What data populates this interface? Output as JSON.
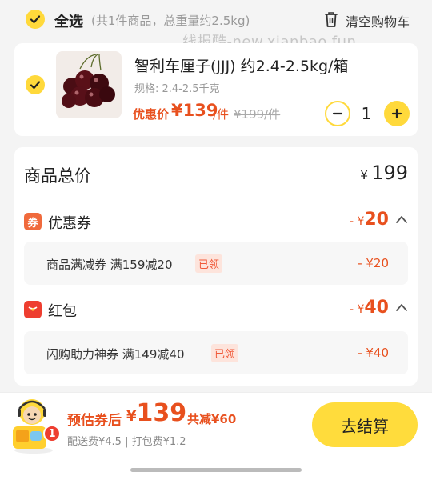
{
  "header": {
    "select_all_label": "全选",
    "select_all_summary": "(共1件商品，总重量约2.5kg)",
    "clear_cart_label": "清空购物车",
    "watermark": "线报酷-new.xianbao.fun"
  },
  "item": {
    "title": "智利车厘子(JJJ) 约2.4-2.5kg/箱",
    "spec": "规格: 2.4-2.5千克",
    "price_prefix": "优惠价",
    "price": "¥139",
    "price_unit": "/件",
    "original_price": "¥199/件",
    "quantity": "1"
  },
  "summary": {
    "total_label": "商品总价",
    "total_yen": "¥",
    "total_value": "199",
    "coupon": {
      "icon_text": "券",
      "label": "优惠券",
      "amount_prefix": "- ¥",
      "amount": "20",
      "detail_text": "商品满减券 满159减20",
      "detail_badge": "已领",
      "detail_amount": "- ¥20"
    },
    "hongbao": {
      "label": "红包",
      "amount_prefix": "- ¥",
      "amount": "40",
      "detail_text": "闪购助力神券 满149减40",
      "detail_badge": "已领",
      "detail_amount": "- ¥40"
    }
  },
  "footer": {
    "cart_count": "1",
    "estimate_label": "预估券后",
    "estimate_yen": "¥",
    "estimate_value": "139",
    "total_reduce": "共减¥60",
    "fees": "配送费¥4.5 | 打包费¥1.2",
    "checkout_label": "去结算"
  },
  "colors": {
    "accent_yellow": "#ffd93b",
    "price_red": "#e8501e",
    "badge_red": "#ee3e30"
  },
  "icons": [
    "check-icon",
    "trash-icon",
    "minus-icon",
    "plus-icon",
    "coupon-icon",
    "hongbao-icon",
    "chevron-up-icon",
    "mascot-icon"
  ]
}
